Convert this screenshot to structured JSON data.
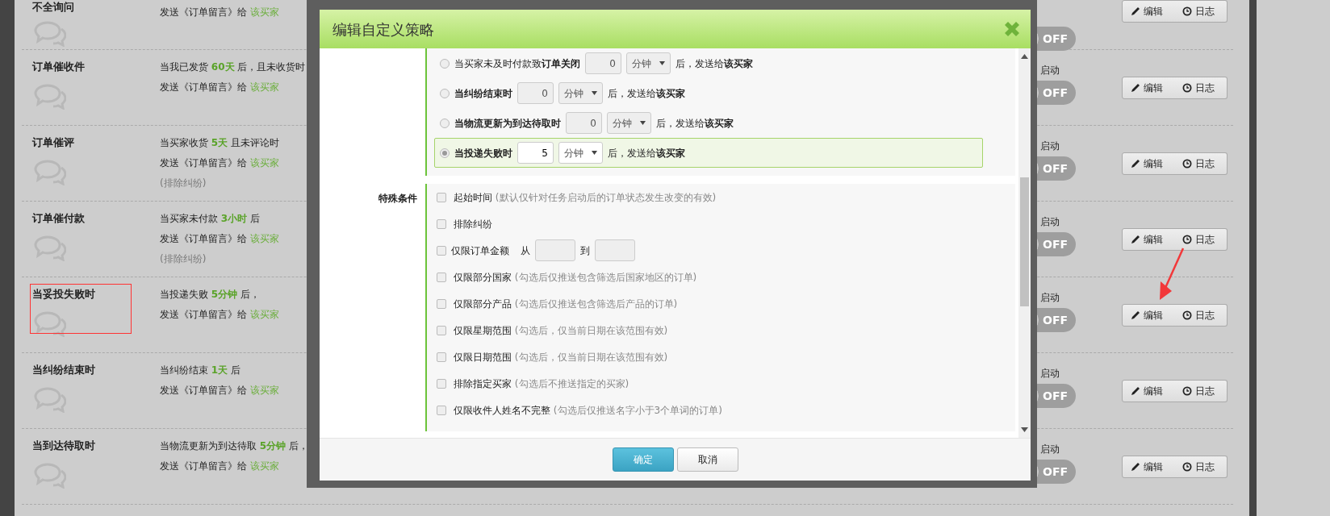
{
  "rows": [
    {
      "title": "不全询问",
      "conditions": [],
      "send": {
        "text": "发送《订单留言》给",
        "target": "该买家"
      },
      "toggle": "OFF",
      "on": false,
      "marked": false,
      "buttons": [
        {
          "kind": "edit",
          "label": "编辑"
        },
        {
          "kind": "log",
          "label": "日志"
        }
      ]
    },
    {
      "title": "订单催收件",
      "conditions": [
        "当我已发货 **60天** 后，且未收货时"
      ],
      "send": {
        "text": "发送《订单留言》给",
        "target": "该买家"
      },
      "status": "启动",
      "toggle": "OFF",
      "on": false,
      "marked": false,
      "buttons": [
        {
          "kind": "edit",
          "label": "编辑"
        },
        {
          "kind": "log",
          "label": "日志"
        }
      ]
    },
    {
      "title": "订单催评",
      "conditions": [
        "当买家收货 **5天** 且未评论时"
      ],
      "send": {
        "text": "发送《订单留言》给",
        "target": "该买家"
      },
      "note": "(排除纠纷)",
      "status": "启动",
      "toggle": "OFF",
      "on": false,
      "marked": false,
      "buttons": [
        {
          "kind": "edit",
          "label": "编辑"
        },
        {
          "kind": "log",
          "label": "日志"
        }
      ]
    },
    {
      "title": "订单催付款",
      "conditions": [
        "当买家未付款 **3小时** 后"
      ],
      "send": {
        "text": "发送《订单留言》给",
        "target": "该买家"
      },
      "note": "(排除纠纷)",
      "status": "启动",
      "toggle": "OFF",
      "on": false,
      "marked": false,
      "buttons": [
        {
          "kind": "edit",
          "label": "编辑"
        },
        {
          "kind": "log",
          "label": "日志"
        }
      ]
    },
    {
      "title": "当妥投失败时",
      "conditions": [
        "当投递失败  **5分钟** 后，"
      ],
      "send": {
        "text": "发送《订单留言》给",
        "target": "该买家"
      },
      "status": "启动",
      "toggle": "OFF",
      "on": false,
      "marked": true,
      "buttons": [
        {
          "kind": "edit",
          "label": "编辑"
        },
        {
          "kind": "log",
          "label": "日志"
        }
      ]
    },
    {
      "title": "当纠纷结束时",
      "conditions": [
        "当纠纷结束  **1天** 后"
      ],
      "send": {
        "text": "发送《订单留言》给",
        "target": "该买家"
      },
      "status": "启动",
      "toggle": "OFF",
      "on": false,
      "marked": false,
      "buttons": [
        {
          "kind": "edit",
          "label": "编辑"
        },
        {
          "kind": "log",
          "label": "日志"
        }
      ]
    },
    {
      "title": "当到达待取时",
      "conditions": [
        "当物流更新为到达待取  **5分钟** 后，"
      ],
      "send": {
        "text": "发送《订单留言》给",
        "target": "该买家"
      },
      "status": "启动",
      "toggle": "OFF",
      "on": false,
      "marked": false,
      "buttons": [
        {
          "kind": "edit",
          "label": "编辑"
        },
        {
          "kind": "log",
          "label": "日志"
        }
      ]
    }
  ],
  "modal": {
    "title": "编辑自定义策略",
    "radio_options": [
      {
        "text": "当买家未及时付款致**订单关闭**",
        "bold": false,
        "value": "0",
        "unit": "分钟",
        "suffix": "后，发送给**该买家**",
        "selected": false
      },
      {
        "text": "当纠纷结束时",
        "bold": true,
        "value": "0",
        "unit": "分钟",
        "suffix": "后，发送给**该买家**",
        "selected": false
      },
      {
        "text": "当物流更新为到达待取时",
        "bold": true,
        "value": "0",
        "unit": "分钟",
        "suffix": "后，发送给**该买家**",
        "selected": false
      },
      {
        "text": "当投递失败时",
        "bold": true,
        "value": "5",
        "unit": "分钟",
        "suffix": "后，发送给**该买家**",
        "selected": true
      }
    ],
    "special_label": "特殊条件",
    "checkboxes": [
      {
        "kind": "plain",
        "label": "起始时间",
        "hint": "(默认仅针对任务启动后的订单状态发生改变的有效)",
        "checked": false
      },
      {
        "kind": "plain",
        "label": "排除纠纷",
        "checked": false
      },
      {
        "kind": "range",
        "label": "仅限订单金额",
        "from": "从",
        "to": "到",
        "checked": false
      },
      {
        "kind": "plain",
        "label": "仅限部分国家",
        "hint": "(勾选后仅推送包含筛选后国家地区的订单)",
        "checked": false
      },
      {
        "kind": "plain",
        "label": "仅限部分产品",
        "hint": "(勾选后仅推送包含筛选后产品的订单)",
        "checked": false
      },
      {
        "kind": "plain",
        "label": "仅限星期范围",
        "hint": "(勾选后，仅当前日期在该范围有效)",
        "checked": false
      },
      {
        "kind": "plain",
        "label": "仅限日期范围",
        "hint": "(勾选后，仅当前日期在该范围有效)",
        "checked": false
      },
      {
        "kind": "plain",
        "label": "排除指定买家",
        "hint": "(勾选后不推送指定的买家)",
        "checked": false
      },
      {
        "kind": "plain",
        "label": "仅限收件人姓名不完整",
        "hint": "(勾选后仅推送名字小于3个单词的订单)",
        "checked": false
      }
    ],
    "buttons": [
      {
        "kind": "primary",
        "label": "确定"
      },
      {
        "kind": "secondary",
        "label": "取消"
      }
    ]
  }
}
